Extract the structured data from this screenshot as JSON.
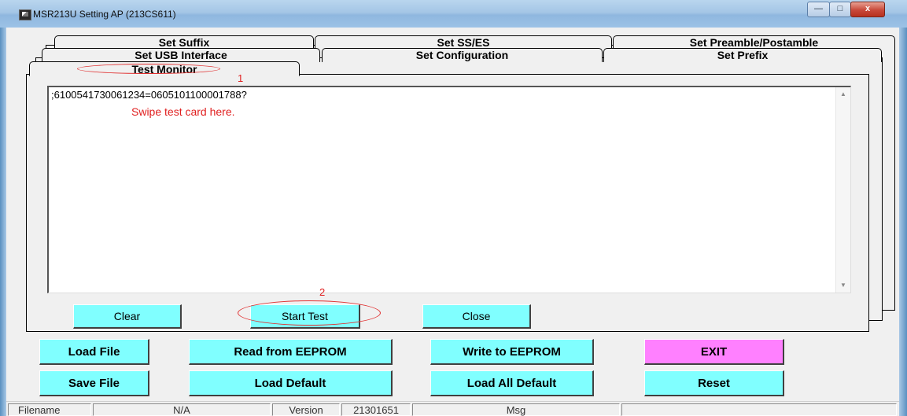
{
  "window": {
    "title": "MSR213U Setting AP (213CS611)",
    "controls": {
      "minimize": "—",
      "maximize": "□",
      "close": "x"
    }
  },
  "tabs": {
    "row1": [
      "Set Suffix",
      "Set SS/ES",
      "Set Preamble/Postamble"
    ],
    "row2": [
      "Set USB Interface",
      "Set Configuration",
      "Set Prefix"
    ],
    "active": "Test Monitor"
  },
  "annotations": {
    "marker1": "1",
    "marker2": "2"
  },
  "monitor": {
    "line1": ";6100541730061234=0605101100001788?",
    "line2": "Swipe test card here."
  },
  "test_buttons": {
    "clear": "Clear",
    "start": "Start Test",
    "close": "Close"
  },
  "main_buttons": {
    "load_file": "Load File",
    "read_eeprom": "Read from EEPROM",
    "write_eeprom": "Write to EEPROM",
    "exit": "EXIT",
    "save_file": "Save File",
    "load_default": "Load Default",
    "load_all_default": "Load  All Default",
    "reset": "Reset"
  },
  "status": {
    "filename_label": "Filename",
    "filename_value": "N/A",
    "version_label": "Version",
    "version_value": "21301651",
    "msg_label": "Msg",
    "msg_value": ""
  },
  "colors": {
    "button_cyan": "#80ffff",
    "exit_pink": "#ff80ff",
    "annotation_red": "#e02020"
  }
}
